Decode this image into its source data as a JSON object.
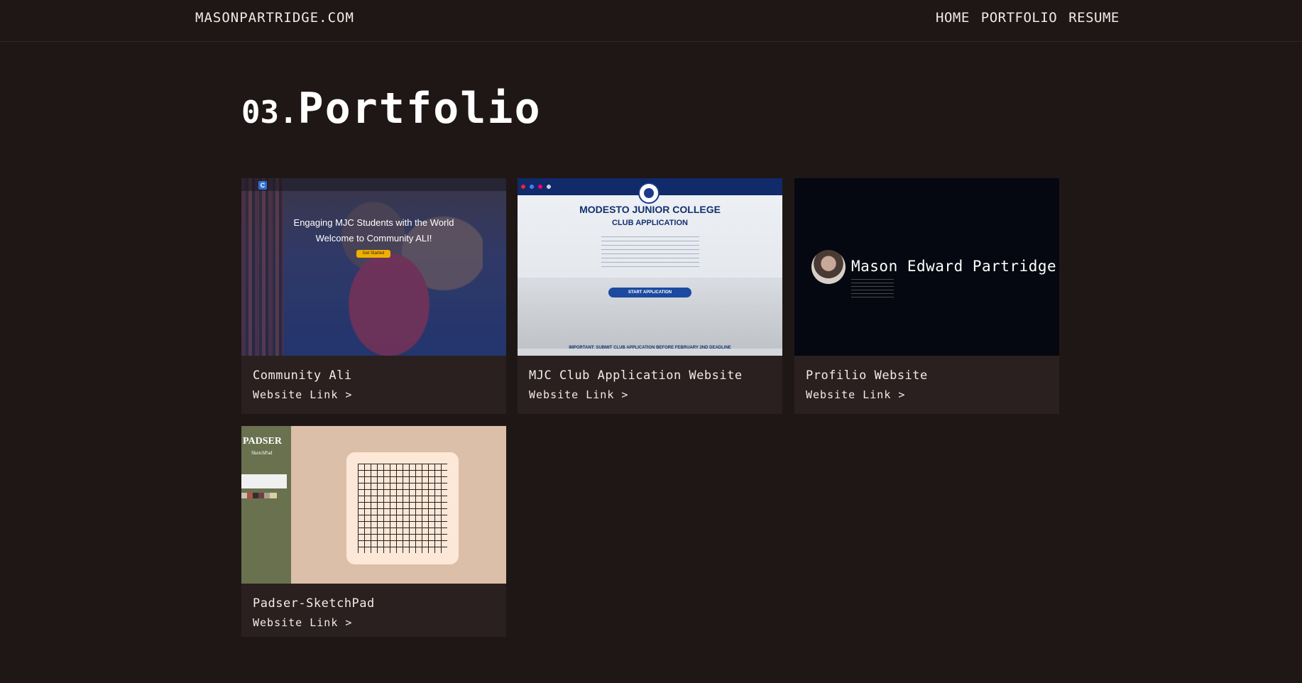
{
  "nav": {
    "brand": "MASONPARTRIDGE.COM",
    "links": [
      "HOME",
      "PORTFOLIO",
      "RESUME"
    ]
  },
  "page": {
    "number": "03.",
    "title": "Portfolio"
  },
  "projects": [
    {
      "title": "Community Ali",
      "link_label": "Website Link >",
      "thumb": {
        "headline1": "Engaging MJC Students with the World",
        "headline2": "Welcome to Community ALI!",
        "button": "Get Started"
      }
    },
    {
      "title": "MJC Club Application Website",
      "link_label": "Website Link >",
      "thumb": {
        "headline": "MODESTO JUNIOR COLLEGE",
        "subheadline": "CLUB APPLICATION",
        "button": "START APPLICATION",
        "footer": "IMPORTANT: SUBMIT CLUB APPLICATION BEFORE FEBRUARY 2ND DEADLINE"
      }
    },
    {
      "title": "Profilio Website",
      "link_label": "Website Link >",
      "thumb": {
        "name": "Mason Edward Partridge"
      }
    },
    {
      "title": "Padser-SketchPad",
      "link_label": "Website Link >",
      "thumb": {
        "logo": "PADSER",
        "sub": "SketchPad"
      }
    }
  ],
  "colors": {
    "background": "#1f1716",
    "card": "#2a201f",
    "text": "#f3ece6"
  }
}
